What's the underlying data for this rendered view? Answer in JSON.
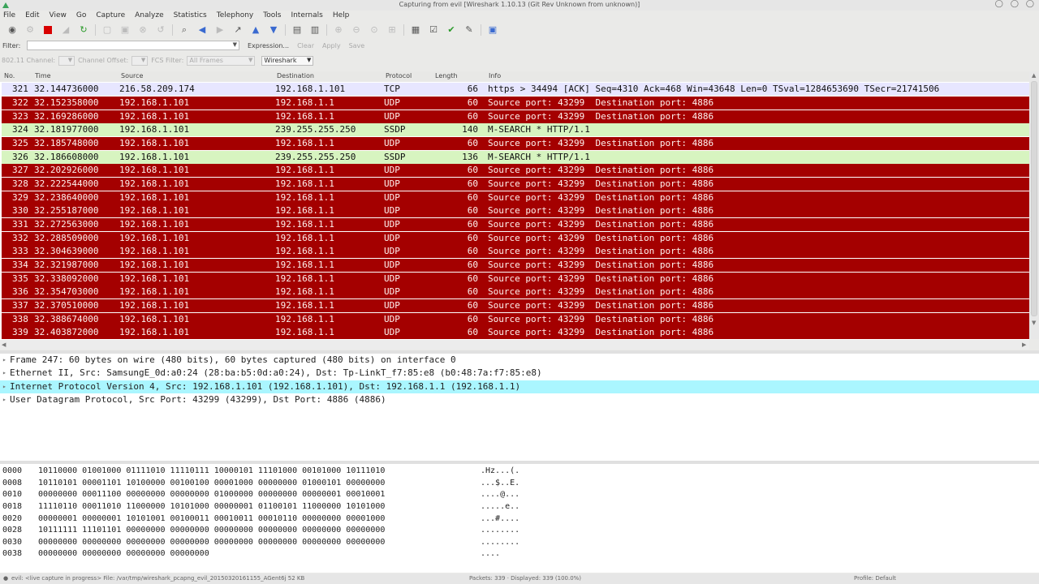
{
  "window": {
    "title": "Capturing from evil   [Wireshark 1.10.13  (Git Rev Unknown from unknown)]"
  },
  "menu": [
    "File",
    "Edit",
    "View",
    "Go",
    "Capture",
    "Analyze",
    "Statistics",
    "Telephony",
    "Tools",
    "Internals",
    "Help"
  ],
  "filter": {
    "label": "Filter:",
    "value": "",
    "expression": "Expression...",
    "clear": "Clear",
    "apply": "Apply",
    "save": "Save"
  },
  "wireless": {
    "channel_label": "802.11 Channel:",
    "offset_label": "Channel Offset:",
    "fcs_label": "FCS Filter:",
    "fcs_value": "All Frames",
    "decode_value": "Wireshark"
  },
  "columns": {
    "no": "No.",
    "time": "Time",
    "source": "Source",
    "destination": "Destination",
    "protocol": "Protocol",
    "length": "Length",
    "info": "Info"
  },
  "packets": [
    {
      "no": "321",
      "time": "32.144736000",
      "src": "216.58.209.174",
      "dst": "192.168.1.101",
      "proto": "TCP",
      "len": "66",
      "info": "https > 34494 [ACK] Seq=4310 Ack=468 Win=43648 Len=0 TSval=1284653690 TSecr=21741506",
      "kind": "tcp"
    },
    {
      "no": "322",
      "time": "32.152358000",
      "src": "192.168.1.101",
      "dst": "192.168.1.1",
      "proto": "UDP",
      "len": "60",
      "info": "Source port: 43299  Destination port: 4886",
      "kind": "udp"
    },
    {
      "no": "323",
      "time": "32.169286000",
      "src": "192.168.1.101",
      "dst": "192.168.1.1",
      "proto": "UDP",
      "len": "60",
      "info": "Source port: 43299  Destination port: 4886",
      "kind": "udp"
    },
    {
      "no": "324",
      "time": "32.181977000",
      "src": "192.168.1.101",
      "dst": "239.255.255.250",
      "proto": "SSDP",
      "len": "140",
      "info": "M-SEARCH * HTTP/1.1",
      "kind": "ssdp"
    },
    {
      "no": "325",
      "time": "32.185748000",
      "src": "192.168.1.101",
      "dst": "192.168.1.1",
      "proto": "UDP",
      "len": "60",
      "info": "Source port: 43299  Destination port: 4886",
      "kind": "udp"
    },
    {
      "no": "326",
      "time": "32.186608000",
      "src": "192.168.1.101",
      "dst": "239.255.255.250",
      "proto": "SSDP",
      "len": "136",
      "info": "M-SEARCH * HTTP/1.1",
      "kind": "ssdp"
    },
    {
      "no": "327",
      "time": "32.202926000",
      "src": "192.168.1.101",
      "dst": "192.168.1.1",
      "proto": "UDP",
      "len": "60",
      "info": "Source port: 43299  Destination port: 4886",
      "kind": "udp"
    },
    {
      "no": "328",
      "time": "32.222544000",
      "src": "192.168.1.101",
      "dst": "192.168.1.1",
      "proto": "UDP",
      "len": "60",
      "info": "Source port: 43299  Destination port: 4886",
      "kind": "udp"
    },
    {
      "no": "329",
      "time": "32.238640000",
      "src": "192.168.1.101",
      "dst": "192.168.1.1",
      "proto": "UDP",
      "len": "60",
      "info": "Source port: 43299  Destination port: 4886",
      "kind": "udp"
    },
    {
      "no": "330",
      "time": "32.255187000",
      "src": "192.168.1.101",
      "dst": "192.168.1.1",
      "proto": "UDP",
      "len": "60",
      "info": "Source port: 43299  Destination port: 4886",
      "kind": "udp"
    },
    {
      "no": "331",
      "time": "32.272563000",
      "src": "192.168.1.101",
      "dst": "192.168.1.1",
      "proto": "UDP",
      "len": "60",
      "info": "Source port: 43299  Destination port: 4886",
      "kind": "udp"
    },
    {
      "no": "332",
      "time": "32.288509000",
      "src": "192.168.1.101",
      "dst": "192.168.1.1",
      "proto": "UDP",
      "len": "60",
      "info": "Source port: 43299  Destination port: 4886",
      "kind": "udp"
    },
    {
      "no": "333",
      "time": "32.304639000",
      "src": "192.168.1.101",
      "dst": "192.168.1.1",
      "proto": "UDP",
      "len": "60",
      "info": "Source port: 43299  Destination port: 4886",
      "kind": "udp"
    },
    {
      "no": "334",
      "time": "32.321987000",
      "src": "192.168.1.101",
      "dst": "192.168.1.1",
      "proto": "UDP",
      "len": "60",
      "info": "Source port: 43299  Destination port: 4886",
      "kind": "udp"
    },
    {
      "no": "335",
      "time": "32.338092000",
      "src": "192.168.1.101",
      "dst": "192.168.1.1",
      "proto": "UDP",
      "len": "60",
      "info": "Source port: 43299  Destination port: 4886",
      "kind": "udp"
    },
    {
      "no": "336",
      "time": "32.354703000",
      "src": "192.168.1.101",
      "dst": "192.168.1.1",
      "proto": "UDP",
      "len": "60",
      "info": "Source port: 43299  Destination port: 4886",
      "kind": "udp"
    },
    {
      "no": "337",
      "time": "32.370510000",
      "src": "192.168.1.101",
      "dst": "192.168.1.1",
      "proto": "UDP",
      "len": "60",
      "info": "Source port: 43299  Destination port: 4886",
      "kind": "udp"
    },
    {
      "no": "338",
      "time": "32.388674000",
      "src": "192.168.1.101",
      "dst": "192.168.1.1",
      "proto": "UDP",
      "len": "60",
      "info": "Source port: 43299  Destination port: 4886",
      "kind": "udp"
    },
    {
      "no": "339",
      "time": "32.403872000",
      "src": "192.168.1.101",
      "dst": "192.168.1.1",
      "proto": "UDP",
      "len": "60",
      "info": "Source port: 43299  Destination port: 4886",
      "kind": "udp"
    }
  ],
  "details": [
    {
      "text": "Frame 247: 60 bytes on wire (480 bits), 60 bytes captured (480 bits) on interface 0",
      "selected": false
    },
    {
      "text": "Ethernet II, Src: SamsungE_0d:a0:24 (28:ba:b5:0d:a0:24), Dst: Tp-LinkT_f7:85:e8 (b0:48:7a:f7:85:e8)",
      "selected": false
    },
    {
      "text": "Internet Protocol Version 4, Src: 192.168.1.101 (192.168.1.101), Dst: 192.168.1.1 (192.168.1.1)",
      "selected": true
    },
    {
      "text": "User Datagram Protocol, Src Port: 43299 (43299), Dst Port: 4886 (4886)",
      "selected": false
    }
  ],
  "hex": [
    {
      "off": "0000",
      "bits": "10110000 01001000 01111010 11110111 10000101 11101000 00101000 10111010",
      "ascii": ".Hz...(."
    },
    {
      "off": "0008",
      "bits": "10110101 00001101 10100000 00100100 00001000 00000000 01000101 00000000",
      "ascii": "...$..E."
    },
    {
      "off": "0010",
      "bits": "00000000 00011100 00000000 00000000 01000000 00000000 00000001 00010001",
      "ascii": "....@..."
    },
    {
      "off": "0018",
      "bits": "11110110 00011010 11000000 10101000 00000001 01100101 11000000 10101000",
      "ascii": ".....e.."
    },
    {
      "off": "0020",
      "bits": "00000001 00000001 10101001 00100011 00010011 00010110 00000000 00001000",
      "ascii": "...#...."
    },
    {
      "off": "0028",
      "bits": "10111111 11101101 00000000 00000000 00000000 00000000 00000000 00000000",
      "ascii": "........"
    },
    {
      "off": "0030",
      "bits": "00000000 00000000 00000000 00000000 00000000 00000000 00000000 00000000",
      "ascii": "........"
    },
    {
      "off": "0038",
      "bits": "00000000 00000000 00000000 00000000",
      "ascii": "...."
    }
  ],
  "status": {
    "left": "evil: <live capture in progress> File: /var/tmp/wireshark_pcapng_evil_20150320161155_AGent6j 52 KB",
    "middle": "Packets: 339 · Displayed: 339 (100.0%)",
    "right": "Profile: Default"
  },
  "colors": {
    "udp_bg": "#a40000",
    "ssdp_bg": "#d7f4c0",
    "tcp_bg": "#e7e6ff",
    "selected_detail": "#aaf6ff"
  }
}
